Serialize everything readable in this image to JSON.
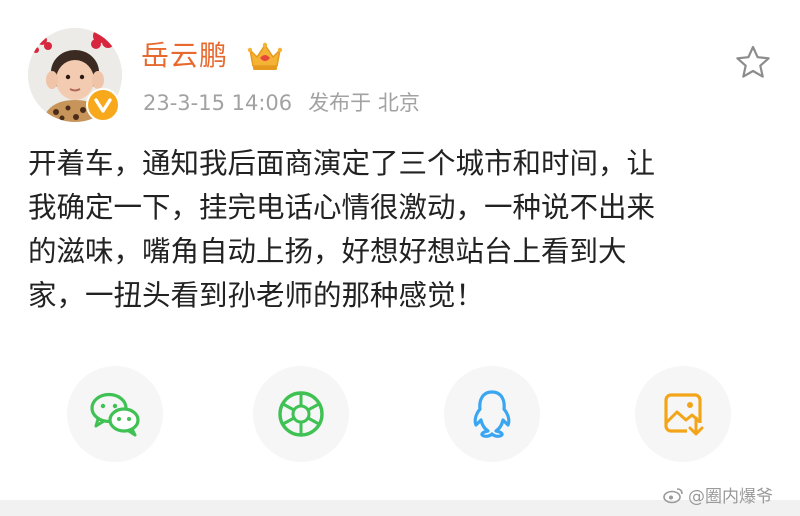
{
  "post": {
    "username": "岳云鹏",
    "date": "23-3-15 14:06",
    "location_label": "发布于 北京",
    "text": "开着车，通知我后面商演定了三个城市和时间，让\n我确定一下，挂完电话心情很激动，一种说不出来\n的滋味，嘴角自动上扬，好想好想站台上看到大\n家，一扭头看到孙老师的那种感觉！"
  },
  "share": [
    {
      "name": "wechat-icon",
      "color": "#3fc153"
    },
    {
      "name": "moments-icon",
      "color": "#3fc153"
    },
    {
      "name": "qq-icon",
      "color": "#3aa6f2"
    },
    {
      "name": "save-image-icon",
      "color": "#f3a51a"
    }
  ],
  "watermark": {
    "text": "@圈内爆爷"
  }
}
